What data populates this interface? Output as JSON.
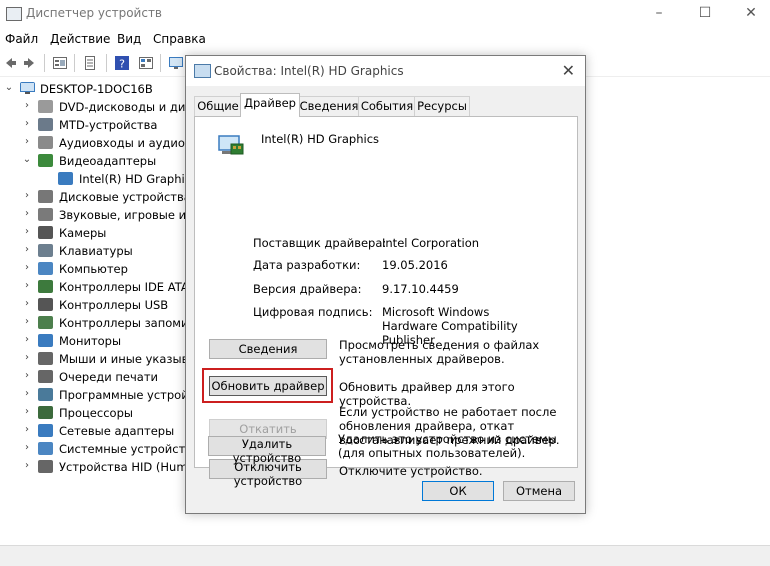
{
  "window": {
    "title": "Диспетчер устройств",
    "minimize": "–",
    "maximize": "☐",
    "close": "✕"
  },
  "menu": [
    "Файл",
    "Действие",
    "Вид",
    "Справка"
  ],
  "tree": {
    "root": "DESKTOP-1DOC16B",
    "items": [
      {
        "label": "DVD-дисководы и диск",
        "expanded": false,
        "child": false,
        "color": "#9a9a9a"
      },
      {
        "label": "MTD-устройства",
        "expanded": false,
        "child": false,
        "color": "#6b7a8a"
      },
      {
        "label": "Аудиовходы и аудиов",
        "expanded": false,
        "child": false,
        "color": "#8a8a8a"
      },
      {
        "label": "Видеоадаптеры",
        "expanded": true,
        "child": false,
        "color": "#3c8a3c"
      },
      {
        "label": "Intel(R) HD Graphics",
        "expanded": false,
        "child": true,
        "color": "#3a7bbf"
      },
      {
        "label": "Дисковые устройства",
        "expanded": false,
        "child": false,
        "color": "#777"
      },
      {
        "label": "Звуковые, игровые и в",
        "expanded": false,
        "child": false,
        "color": "#7a7a7a"
      },
      {
        "label": "Камеры",
        "expanded": false,
        "child": false,
        "color": "#555"
      },
      {
        "label": "Клавиатуры",
        "expanded": false,
        "child": false,
        "color": "#6d7f8f"
      },
      {
        "label": "Компьютер",
        "expanded": false,
        "child": false,
        "color": "#4b86c2"
      },
      {
        "label": "Контроллеры IDE ATA/A",
        "expanded": false,
        "child": false,
        "color": "#3d7a3d"
      },
      {
        "label": "Контроллеры USB",
        "expanded": false,
        "child": false,
        "color": "#555"
      },
      {
        "label": "Контроллеры запомин",
        "expanded": false,
        "child": false,
        "color": "#4d7f4d"
      },
      {
        "label": "Мониторы",
        "expanded": false,
        "child": false,
        "color": "#3a7bbf"
      },
      {
        "label": "Мыши и иные указыв",
        "expanded": false,
        "child": false,
        "color": "#666"
      },
      {
        "label": "Очереди печати",
        "expanded": false,
        "child": false,
        "color": "#666"
      },
      {
        "label": "Программные устрой",
        "expanded": false,
        "child": false,
        "color": "#4a7a9a"
      },
      {
        "label": "Процессоры",
        "expanded": false,
        "child": false,
        "color": "#3c6a3c"
      },
      {
        "label": "Сетевые адаптеры",
        "expanded": false,
        "child": false,
        "color": "#3a7bbf"
      },
      {
        "label": "Системные устройства",
        "expanded": false,
        "child": false,
        "color": "#4b86c2"
      },
      {
        "label": "Устройства HID (Huma",
        "expanded": false,
        "child": false,
        "color": "#666"
      }
    ]
  },
  "dialog": {
    "title": "Свойства: Intel(R) HD Graphics",
    "close": "✕",
    "tabs": [
      "Общие",
      "Драйвер",
      "Сведения",
      "События",
      "Ресурсы"
    ],
    "active_tab": "Драйвер",
    "device_name": "Intel(R) HD Graphics",
    "props": [
      {
        "label": "Поставщик драйвера:",
        "value": "Intel Corporation"
      },
      {
        "label": "Дата разработки:",
        "value": "19.05.2016"
      },
      {
        "label": "Версия драйвера:",
        "value": "9.17.10.4459"
      },
      {
        "label": "Цифровая подпись:",
        "value": "Microsoft Windows Hardware Compatibility Publisher"
      }
    ],
    "actions": [
      {
        "button": "Сведения",
        "desc": "Просмотреть сведения о файлах установленных драйверов.",
        "enabled": true
      },
      {
        "button": "Обновить драйвер",
        "desc": "Обновить драйвер для этого устройства.",
        "enabled": true
      },
      {
        "button": "Откатить",
        "desc": "Если устройство не работает после обновления драйвера, откат восстанавливает прежний драйвер.",
        "enabled": false
      },
      {
        "button": "Отключить устройство",
        "desc": "Отключите устройство.",
        "enabled": true
      },
      {
        "button": "Удалить устройство",
        "desc": "Удалить это устройство из системы (для опытных пользователей).",
        "enabled": true
      }
    ],
    "ok": "ОК",
    "cancel": "Отмена"
  },
  "colors": {
    "highlight": "#cc1f1f",
    "ok_border": "#0078d7"
  }
}
